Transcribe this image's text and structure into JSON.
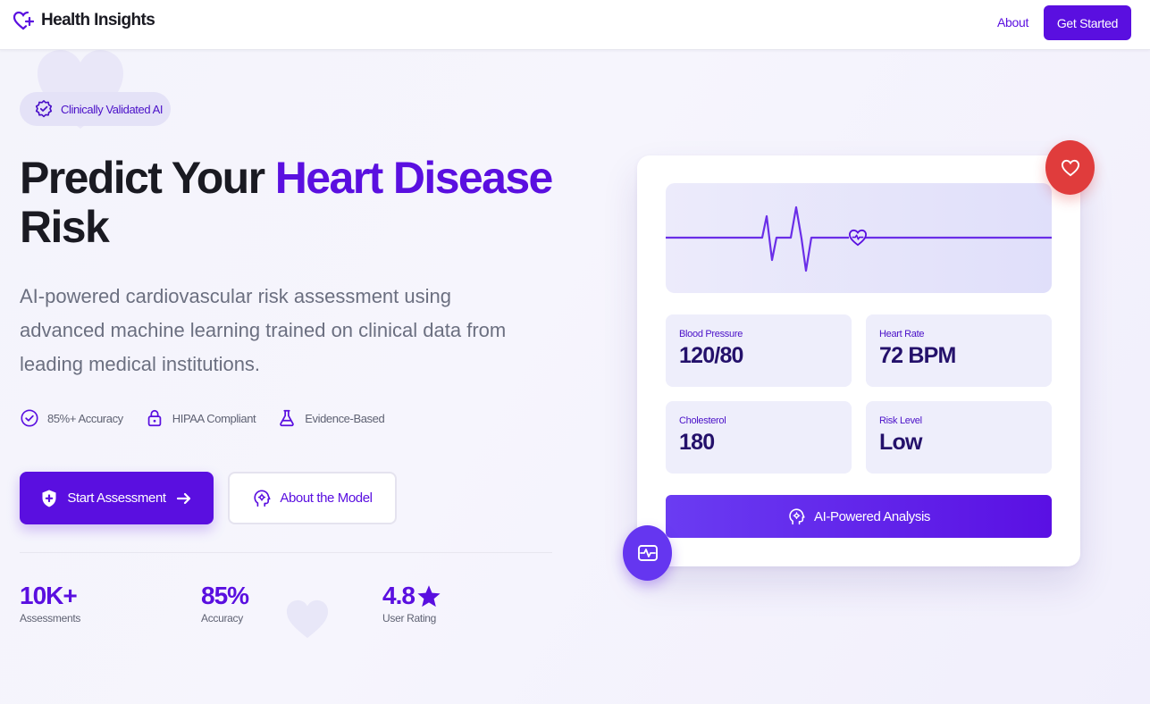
{
  "nav": {
    "brand": "Health Insights",
    "about_link": "About",
    "cta": "Get Started"
  },
  "hero": {
    "badge": "Clinically Validated AI",
    "headline_part1": "Predict Your ",
    "headline_accent": "Heart Disease",
    "headline_part2": "Risk",
    "subtitle": "AI-powered cardiovascular risk assessment using advanced machine learning trained on clinical data from leading medical institutions.",
    "features": [
      {
        "label": "85%+ Accuracy",
        "icon": "check-circle-icon"
      },
      {
        "label": "HIPAA Compliant",
        "icon": "lock-icon"
      },
      {
        "label": "Evidence-Based",
        "icon": "flask-icon"
      }
    ],
    "primary_button": "Start Assessment",
    "secondary_button": "About the Model",
    "stats": [
      {
        "value": "10K+",
        "label": "Assessments"
      },
      {
        "value": "85%",
        "label": "Accuracy"
      },
      {
        "value": "4.8",
        "label": "User Rating"
      }
    ]
  },
  "card": {
    "metrics": [
      {
        "label": "Blood Pressure",
        "value": "120/80"
      },
      {
        "label": "Heart Rate",
        "value": "72 BPM"
      },
      {
        "label": "Cholesterol",
        "value": "180"
      },
      {
        "label": "Risk Level",
        "value": "Low"
      }
    ],
    "analysis_button": "AI-Powered Analysis"
  },
  "colors": {
    "accent": "#5a0fe0",
    "danger": "#e03c3c",
    "metric_bg": "#eeeefb"
  }
}
